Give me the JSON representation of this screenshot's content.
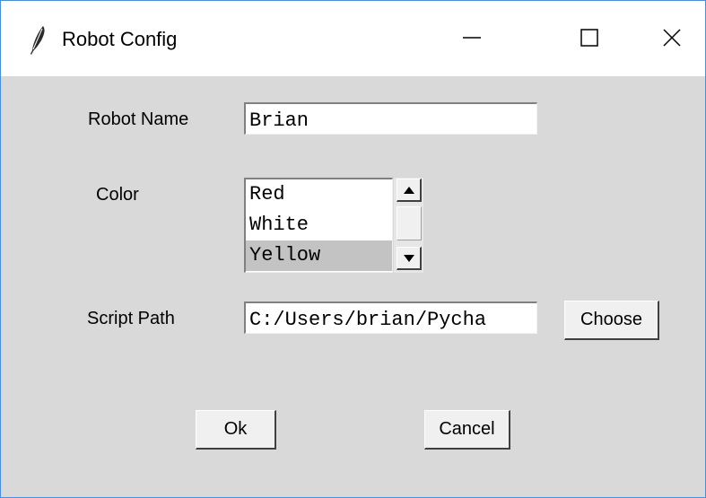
{
  "window": {
    "title": "Robot Config",
    "icon": "feather-icon",
    "controls": [
      "minimize-icon",
      "maximize-icon",
      "close-icon"
    ]
  },
  "form": {
    "robot_name": {
      "label": "Robot Name",
      "value": "Brian"
    },
    "color": {
      "label": "Color",
      "options": [
        "Red",
        "White",
        "Yellow"
      ],
      "selected": "Yellow"
    },
    "script_path": {
      "label": "Script Path",
      "value": "C:/Users/brian/Pycha",
      "choose_label": "Choose"
    }
  },
  "actions": {
    "ok_label": "Ok",
    "cancel_label": "Cancel"
  },
  "colors": {
    "selection": "#c3c3c3",
    "background": "#d9d9d9"
  }
}
